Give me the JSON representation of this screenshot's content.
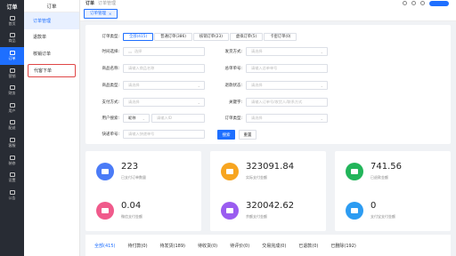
{
  "sidebar": {
    "logo": "订单",
    "items": [
      {
        "label": "首页",
        "icon": "home-icon"
      },
      {
        "label": "商品",
        "icon": "goods-icon"
      },
      {
        "label": "订单",
        "icon": "order-icon",
        "active": true
      },
      {
        "label": "营销",
        "icon": "marketing-icon"
      },
      {
        "label": "财务",
        "icon": "finance-icon"
      },
      {
        "label": "用户",
        "icon": "user-icon"
      },
      {
        "label": "配送",
        "icon": "delivery-icon"
      },
      {
        "label": "客服",
        "icon": "service-icon"
      },
      {
        "label": "装修",
        "icon": "decorate-icon"
      },
      {
        "label": "设置",
        "icon": "settings-icon"
      },
      {
        "label": "公告",
        "icon": "notice-icon"
      }
    ]
  },
  "submenu": {
    "title": "订单",
    "items": [
      "订单管理",
      "退款单",
      "核销订单",
      "代客下单"
    ]
  },
  "topbar": {
    "crumb": "订单",
    "crumb2": "订单管理"
  },
  "tagsbar": {
    "tab_label": "订单管理",
    "close": "×"
  },
  "filters": {
    "status_label": "订单类型:",
    "status_buttons": [
      "全部(415)",
      "普通订单(386)",
      "核销订单(23)",
      "虚拟订单(5)",
      "卡密订单(0)"
    ],
    "time_label": "时间选择:",
    "time_placeholder": "选择",
    "ship_label": "发货方式:",
    "ship_placeholder": "请选择",
    "product_label": "商品名称:",
    "product_placeholder": "请输入商品名称",
    "order_no_label": "总单单号:",
    "order_no_placeholder": "请输入总单单号",
    "product_type_label": "商品类型:",
    "product_type_placeholder": "请选择",
    "status2_label": "退款状态:",
    "status2_placeholder": "请选择",
    "pay_label": "支付方式:",
    "pay_placeholder": "请选择",
    "keyword_label": "关键字:",
    "keyword_placeholder": "请输入订单号/收货人/联系方式",
    "user_label": "用户搜索:",
    "user_select": "昵称",
    "user_placeholder": "请输入ID",
    "order_type_label": "订单类型:",
    "order_type_placeholder": "请选择",
    "express_label": "快递单号:",
    "express_placeholder": "请输入快递单号",
    "search_button": "搜索",
    "reset_button": "重置"
  },
  "stats": [
    {
      "value": "223",
      "label": "已支付订单数量",
      "color": "#4a7bf7",
      "icon": "order-count-icon"
    },
    {
      "value": "323091.84",
      "label": "实际支付金额",
      "color": "#f7a520",
      "icon": "wallet-icon"
    },
    {
      "value": "741.56",
      "label": "已退款金额",
      "color": "#22b55a",
      "icon": "refund-icon"
    },
    {
      "value": "0.04",
      "label": "微信支付金额",
      "color": "#f05a8b",
      "icon": "wechat-pay-icon"
    },
    {
      "value": "320042.62",
      "label": "余额支付金额",
      "color": "#9a5cf0",
      "icon": "balance-icon"
    },
    {
      "value": "0",
      "label": "支付宝支付金额",
      "color": "#2d9cf2",
      "icon": "alipay-icon"
    }
  ],
  "tabs": [
    "全部(415)",
    "待付款(0)",
    "待发货(189)",
    "待收货(0)",
    "待评价(0)",
    "交易完成(0)",
    "已退款(0)",
    "已删除(192)"
  ]
}
